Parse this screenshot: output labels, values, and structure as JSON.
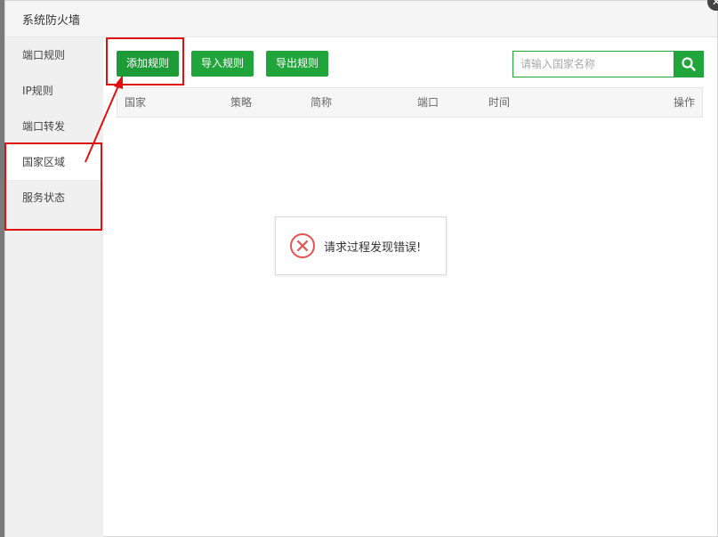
{
  "dialog": {
    "title": "系统防火墙",
    "close_icon": "close-icon"
  },
  "sidebar": {
    "items": [
      {
        "label": "端口规则"
      },
      {
        "label": "IP规则"
      },
      {
        "label": "端口转发"
      },
      {
        "label": "国家区域",
        "active": true
      },
      {
        "label": "服务状态"
      }
    ]
  },
  "toolbar": {
    "add_label": "添加规则",
    "import_label": "导入规则",
    "export_label": "导出规则"
  },
  "search": {
    "placeholder": "请输入国家名称",
    "icon": "search-icon"
  },
  "table": {
    "headers": [
      "国家",
      "策略",
      "简称",
      "端口",
      "时间",
      "操作"
    ]
  },
  "toast": {
    "message": "请求过程发现错误!",
    "icon": "error-circle-icon"
  },
  "colors": {
    "accent": "#20a53a",
    "annotation": "#e01010",
    "error": "#e8534f"
  }
}
